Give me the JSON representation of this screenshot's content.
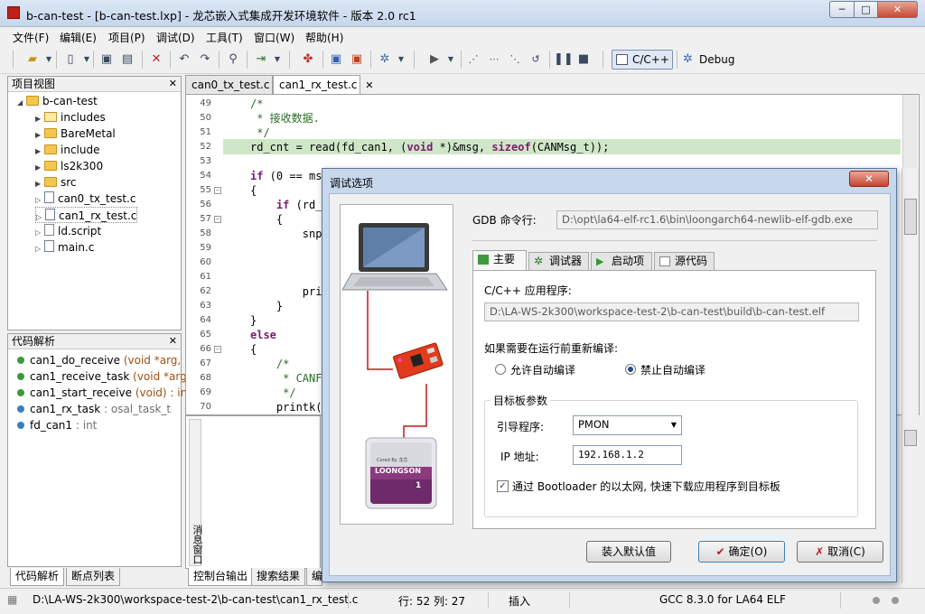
{
  "window": {
    "title": "b-can-test - [b-can-test.lxp] - 龙芯嵌入式集成开发环境软件 - 版本 2.0 rc1",
    "minimize": "─",
    "maximize": "□",
    "close": "✕"
  },
  "menu": [
    "文件(F)",
    "编辑(E)",
    "项目(P)",
    "调试(D)",
    "工具(T)",
    "窗口(W)",
    "帮助(H)"
  ],
  "toolbar": {
    "mode_cpp": "C/C++",
    "mode_debug": "Debug"
  },
  "project_view": {
    "title": "项目视图",
    "close": "✕",
    "root": "b-can-test",
    "items": [
      {
        "label": "includes",
        "icon": "includes-icon"
      },
      {
        "label": "BareMetal",
        "icon": "folder-icon"
      },
      {
        "label": "include",
        "icon": "folder-icon"
      },
      {
        "label": "ls2k300",
        "icon": "folder-icon"
      },
      {
        "label": "src",
        "icon": "folder-icon"
      },
      {
        "label": "can0_tx_test.c",
        "icon": "c-file-icon"
      },
      {
        "label": "can1_rx_test.c",
        "icon": "c-file-icon"
      },
      {
        "label": "ld.script",
        "icon": "script-file-icon"
      },
      {
        "label": "main.c",
        "icon": "c-file-icon"
      }
    ]
  },
  "outline": {
    "title": "代码解析",
    "close": "✕",
    "items": [
      {
        "name": "can1_do_receive",
        "sig": "(void *arg, int",
        "color": "#3c9a3c"
      },
      {
        "name": "can1_receive_task",
        "sig": "(void *arg) : v",
        "color": "#3c9a3c"
      },
      {
        "name": "can1_start_receive",
        "sig": "(void) : int",
        "color": "#3c9a3c"
      },
      {
        "name": "can1_rx_task",
        "sig": ": osal_task_t",
        "color": "#3a7fc0"
      },
      {
        "name": "fd_can1",
        "sig": ": int",
        "color": "#3a7fc0"
      }
    ]
  },
  "left_bottom_tabs": [
    "代码解析",
    "断点列表"
  ],
  "editor": {
    "tabs": [
      {
        "label": "can0_tx_test.c",
        "active": false
      },
      {
        "label": "can1_rx_test.c",
        "active": true,
        "close": "✕"
      }
    ],
    "lines": [
      {
        "no": "49",
        "fold": "",
        "html": "<span class=\"cm\">/*</span>"
      },
      {
        "no": "50",
        "fold": "",
        "html": "<span class=\"cm\"> * 接收数据.</span>"
      },
      {
        "no": "51",
        "fold": "",
        "html": "<span class=\"cm\"> */</span>"
      },
      {
        "no": "52",
        "fold": "",
        "hl": true,
        "html": "rd_cnt = read(fd_can1, (<span class=\"kw\">void</span> *)&amp;msg, <span class=\"kw\">sizeof</span>(CANMsg_t));"
      },
      {
        "no": "53",
        "fold": "",
        "html": ""
      },
      {
        "no": "54",
        "fold": "",
        "html": "<span class=\"kw\">if</span> (0 == ms"
      },
      {
        "no": "55",
        "fold": "−",
        "html": "{"
      },
      {
        "no": "56",
        "fold": "",
        "html": "    <span class=\"kw\">if</span> (rd_"
      },
      {
        "no": "57",
        "fold": "−",
        "html": "    {"
      },
      {
        "no": "58",
        "fold": "",
        "html": "        snp"
      },
      {
        "no": "59",
        "fold": "",
        "html": ""
      },
      {
        "no": "60",
        "fold": "",
        "html": ""
      },
      {
        "no": "61",
        "fold": "",
        "html": ""
      },
      {
        "no": "62",
        "fold": "",
        "html": "        pri"
      },
      {
        "no": "63",
        "fold": "",
        "html": "    }"
      },
      {
        "no": "64",
        "fold": "",
        "html": "}"
      },
      {
        "no": "65",
        "fold": "",
        "html": "<span class=\"kw\">else</span>"
      },
      {
        "no": "66",
        "fold": "−",
        "html": "{"
      },
      {
        "no": "67",
        "fold": "",
        "html": "    <span class=\"cm\">/*</span>"
      },
      {
        "no": "68",
        "fold": "",
        "html": "    <span class=\"cm\"> * CANF</span>"
      },
      {
        "no": "69",
        "fold": "",
        "html": "    <span class=\"cm\"> */</span>"
      },
      {
        "no": "70",
        "fold": "",
        "html": "    printk("
      }
    ]
  },
  "bottom_panel": {
    "vertical_title": "消息窗口",
    "tabs": [
      "控制台输出",
      "搜索结果",
      "编"
    ]
  },
  "status": {
    "path": "D:\\LA-WS-2k300\\workspace-test-2\\b-can-test\\can1_rx_test.c",
    "position": "行: 52 列: 27",
    "mode": "插入",
    "compiler": "GCC 8.3.0 for LA64 ELF"
  },
  "dialog": {
    "title": "调试选项",
    "close": "✕",
    "gdb_label": "GDB 命令行:",
    "gdb_value": "D:\\opt\\la64-elf-rc1.6\\bin\\loongarch64-newlib-elf-gdb.exe",
    "tabs": [
      {
        "label": "主要",
        "icon": "main-tab-icon",
        "active": true
      },
      {
        "label": "调试器",
        "icon": "debugger-gear-icon",
        "active": false
      },
      {
        "label": "启动项",
        "icon": "play-icon",
        "active": false
      },
      {
        "label": "源代码",
        "icon": "source-code-icon",
        "active": false
      }
    ],
    "app_label": "C/C++ 应用程序:",
    "app_value": "D:\\LA-WS-2k300\\workspace-test-2\\b-can-test\\build\\b-can-test.elf",
    "rebuild_label": "如果需要在运行前重新编译:",
    "radio_allow": "允许自动编译",
    "radio_deny": "禁止自动编译",
    "rebuild_selected": "禁止自动编译",
    "target_group": "目标板参数",
    "boot_label": "引导程序:",
    "boot_value": "PMON",
    "ip_label": "IP 地址:",
    "ip_value": "192.168.1.2",
    "checkbox_label": "通过 Bootloader 的以太网, 快速下载应用程序到目标板",
    "checkbox_checked": true,
    "btn_defaults": "装入默认值",
    "btn_ok": "确定(O)",
    "btn_cancel": "取消(C)",
    "chip_brand_small": "Cored By 龙芯",
    "chip_brand": "LOONGSON",
    "chip_number": "1"
  }
}
